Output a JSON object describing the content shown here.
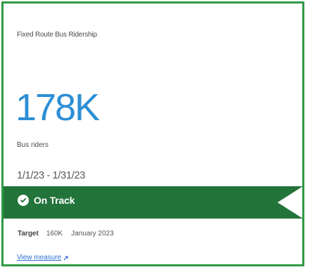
{
  "card": {
    "title": "Fixed Route Bus Ridership",
    "value": "178K",
    "label": "Bus riders",
    "date_range": "1/1/23 - 1/31/23"
  },
  "status": {
    "text": "On Track",
    "icon": "check-icon"
  },
  "target": {
    "label": "Target",
    "value": "160K",
    "period": "January 2023"
  },
  "link": {
    "text": "View measure",
    "icon": "external-link-icon"
  },
  "colors": {
    "border": "#2e9a45",
    "metric": "#2d8fd5",
    "banner": "#23743a",
    "link": "#2d6fd5"
  }
}
